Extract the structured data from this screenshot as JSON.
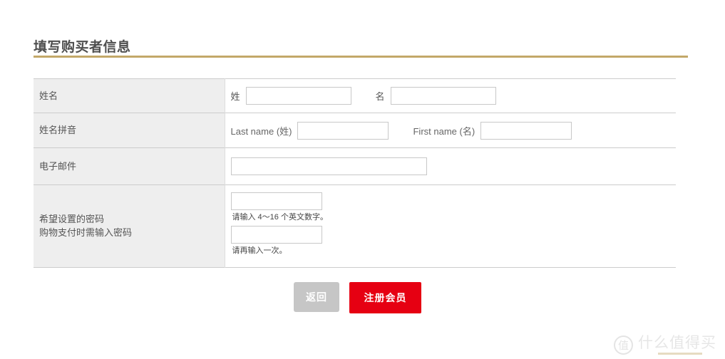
{
  "page": {
    "title": "填写购买者信息",
    "accent_gold": "#c3a869",
    "primary_red": "#e60012"
  },
  "form": {
    "rows": [
      {
        "id": "name",
        "label": "姓名",
        "sub_label": "",
        "fields": [
          {
            "label": "姓",
            "value": "",
            "name": "last-name-input"
          },
          {
            "label": "名",
            "value": "",
            "name": "first-name-input"
          }
        ]
      },
      {
        "id": "pinyin",
        "label": "姓名拼音",
        "sub_label": "",
        "fields": [
          {
            "label": "Last name (姓)",
            "value": "",
            "name": "last-name-pinyin-input"
          },
          {
            "label": "First name (名)",
            "value": "",
            "name": "first-name-pinyin-input"
          }
        ]
      },
      {
        "id": "email",
        "label": "电子邮件",
        "sub_label": "",
        "fields": [
          {
            "label": "",
            "value": "",
            "name": "email-input"
          }
        ]
      },
      {
        "id": "password",
        "label": "希望设置的密码",
        "sub_label": "购物支付时需输入密码",
        "hints": [
          "请输入 4～16 个英文数字。",
          "请再输入一次。"
        ],
        "fields": [
          {
            "label": "",
            "value": "",
            "name": "password-input"
          },
          {
            "label": "",
            "value": "",
            "name": "password-confirm-input"
          }
        ]
      }
    ]
  },
  "actions": {
    "back_label": "返回",
    "register_label": "注册会员"
  },
  "watermark": {
    "mark": "值",
    "text": "什么值得买"
  }
}
